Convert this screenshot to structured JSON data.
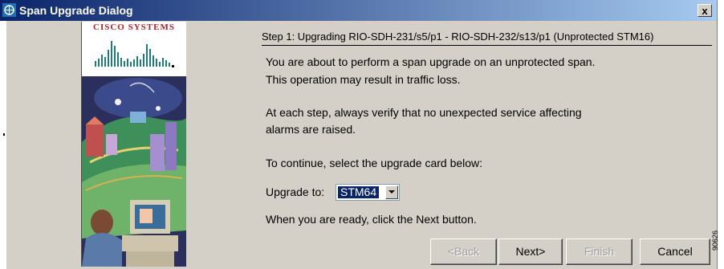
{
  "window": {
    "title": "Span Upgrade Dialog",
    "close_label": "x"
  },
  "art": {
    "logo_text": "CISCO SYSTEMS"
  },
  "content": {
    "step_header": "Step 1: Upgrading RIO-SDH-231/s5/p1 - RIO-SDH-232/s13/p1 (Unprotected STM16)",
    "messages": [
      "You are about to perform a span upgrade on an unprotected span.",
      "This operation may result in traffic loss.",
      "At each step, always verify that no unexpected service affecting",
      "alarms are raised.",
      "To continue, select the upgrade card below:",
      "When you are ready, click the Next button."
    ],
    "upgrade_label": "Upgrade to:",
    "upgrade_value": "STM64"
  },
  "buttons": {
    "back": "<Back",
    "next": "Next>",
    "finish": "Finish",
    "cancel": "Cancel"
  },
  "figure_code": "90626",
  "colors": {
    "title_bar_start": "#0a246a",
    "title_bar_end": "#a6caf0",
    "dialog_bg": "#d4d0c8",
    "selection": "#0a246a",
    "logo_red": "#b2202a",
    "logo_teal": "#1f7a7a"
  }
}
